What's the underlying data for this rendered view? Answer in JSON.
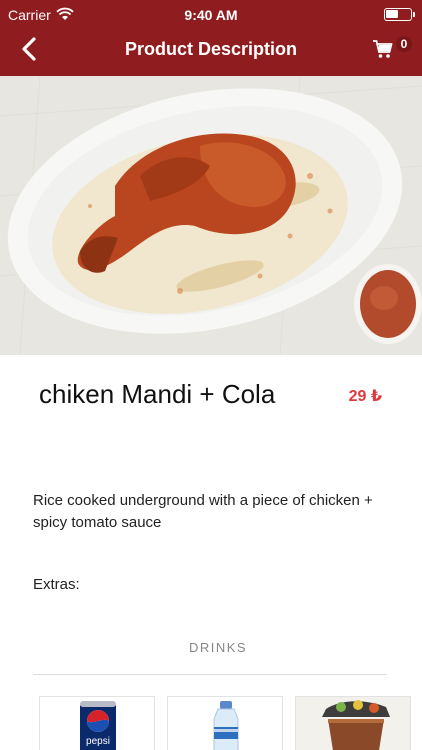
{
  "status_bar": {
    "carrier": "Carrier",
    "time": "9:40 AM"
  },
  "nav": {
    "title": "Product Description",
    "cart_count": "0"
  },
  "colors": {
    "header": "#8f1d1f",
    "price": "#e0383e"
  },
  "product": {
    "name": "chiken Mandi + Cola",
    "price": "29 ₺",
    "description": "Rice cooked underground with a piece of chicken + spicy tomato sauce",
    "extras_label": "Extras:"
  },
  "extras": {
    "section_title": "DRINKS",
    "items": [
      {
        "icon": "pepsi-can",
        "brand_text": "pepsi"
      },
      {
        "icon": "water-bottle"
      },
      {
        "icon": "juice-cup"
      }
    ]
  }
}
